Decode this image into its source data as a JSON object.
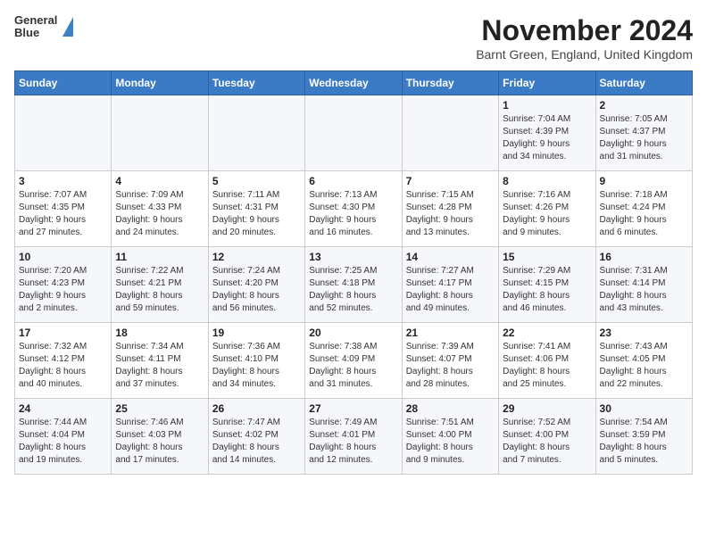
{
  "header": {
    "logo_line1": "General",
    "logo_line2": "Blue",
    "month_title": "November 2024",
    "location": "Barnt Green, England, United Kingdom"
  },
  "weekdays": [
    "Sunday",
    "Monday",
    "Tuesday",
    "Wednesday",
    "Thursday",
    "Friday",
    "Saturday"
  ],
  "weeks": [
    [
      {
        "day": "",
        "info": ""
      },
      {
        "day": "",
        "info": ""
      },
      {
        "day": "",
        "info": ""
      },
      {
        "day": "",
        "info": ""
      },
      {
        "day": "",
        "info": ""
      },
      {
        "day": "1",
        "info": "Sunrise: 7:04 AM\nSunset: 4:39 PM\nDaylight: 9 hours\nand 34 minutes."
      },
      {
        "day": "2",
        "info": "Sunrise: 7:05 AM\nSunset: 4:37 PM\nDaylight: 9 hours\nand 31 minutes."
      }
    ],
    [
      {
        "day": "3",
        "info": "Sunrise: 7:07 AM\nSunset: 4:35 PM\nDaylight: 9 hours\nand 27 minutes."
      },
      {
        "day": "4",
        "info": "Sunrise: 7:09 AM\nSunset: 4:33 PM\nDaylight: 9 hours\nand 24 minutes."
      },
      {
        "day": "5",
        "info": "Sunrise: 7:11 AM\nSunset: 4:31 PM\nDaylight: 9 hours\nand 20 minutes."
      },
      {
        "day": "6",
        "info": "Sunrise: 7:13 AM\nSunset: 4:30 PM\nDaylight: 9 hours\nand 16 minutes."
      },
      {
        "day": "7",
        "info": "Sunrise: 7:15 AM\nSunset: 4:28 PM\nDaylight: 9 hours\nand 13 minutes."
      },
      {
        "day": "8",
        "info": "Sunrise: 7:16 AM\nSunset: 4:26 PM\nDaylight: 9 hours\nand 9 minutes."
      },
      {
        "day": "9",
        "info": "Sunrise: 7:18 AM\nSunset: 4:24 PM\nDaylight: 9 hours\nand 6 minutes."
      }
    ],
    [
      {
        "day": "10",
        "info": "Sunrise: 7:20 AM\nSunset: 4:23 PM\nDaylight: 9 hours\nand 2 minutes."
      },
      {
        "day": "11",
        "info": "Sunrise: 7:22 AM\nSunset: 4:21 PM\nDaylight: 8 hours\nand 59 minutes."
      },
      {
        "day": "12",
        "info": "Sunrise: 7:24 AM\nSunset: 4:20 PM\nDaylight: 8 hours\nand 56 minutes."
      },
      {
        "day": "13",
        "info": "Sunrise: 7:25 AM\nSunset: 4:18 PM\nDaylight: 8 hours\nand 52 minutes."
      },
      {
        "day": "14",
        "info": "Sunrise: 7:27 AM\nSunset: 4:17 PM\nDaylight: 8 hours\nand 49 minutes."
      },
      {
        "day": "15",
        "info": "Sunrise: 7:29 AM\nSunset: 4:15 PM\nDaylight: 8 hours\nand 46 minutes."
      },
      {
        "day": "16",
        "info": "Sunrise: 7:31 AM\nSunset: 4:14 PM\nDaylight: 8 hours\nand 43 minutes."
      }
    ],
    [
      {
        "day": "17",
        "info": "Sunrise: 7:32 AM\nSunset: 4:12 PM\nDaylight: 8 hours\nand 40 minutes."
      },
      {
        "day": "18",
        "info": "Sunrise: 7:34 AM\nSunset: 4:11 PM\nDaylight: 8 hours\nand 37 minutes."
      },
      {
        "day": "19",
        "info": "Sunrise: 7:36 AM\nSunset: 4:10 PM\nDaylight: 8 hours\nand 34 minutes."
      },
      {
        "day": "20",
        "info": "Sunrise: 7:38 AM\nSunset: 4:09 PM\nDaylight: 8 hours\nand 31 minutes."
      },
      {
        "day": "21",
        "info": "Sunrise: 7:39 AM\nSunset: 4:07 PM\nDaylight: 8 hours\nand 28 minutes."
      },
      {
        "day": "22",
        "info": "Sunrise: 7:41 AM\nSunset: 4:06 PM\nDaylight: 8 hours\nand 25 minutes."
      },
      {
        "day": "23",
        "info": "Sunrise: 7:43 AM\nSunset: 4:05 PM\nDaylight: 8 hours\nand 22 minutes."
      }
    ],
    [
      {
        "day": "24",
        "info": "Sunrise: 7:44 AM\nSunset: 4:04 PM\nDaylight: 8 hours\nand 19 minutes."
      },
      {
        "day": "25",
        "info": "Sunrise: 7:46 AM\nSunset: 4:03 PM\nDaylight: 8 hours\nand 17 minutes."
      },
      {
        "day": "26",
        "info": "Sunrise: 7:47 AM\nSunset: 4:02 PM\nDaylight: 8 hours\nand 14 minutes."
      },
      {
        "day": "27",
        "info": "Sunrise: 7:49 AM\nSunset: 4:01 PM\nDaylight: 8 hours\nand 12 minutes."
      },
      {
        "day": "28",
        "info": "Sunrise: 7:51 AM\nSunset: 4:00 PM\nDaylight: 8 hours\nand 9 minutes."
      },
      {
        "day": "29",
        "info": "Sunrise: 7:52 AM\nSunset: 4:00 PM\nDaylight: 8 hours\nand 7 minutes."
      },
      {
        "day": "30",
        "info": "Sunrise: 7:54 AM\nSunset: 3:59 PM\nDaylight: 8 hours\nand 5 minutes."
      }
    ]
  ]
}
